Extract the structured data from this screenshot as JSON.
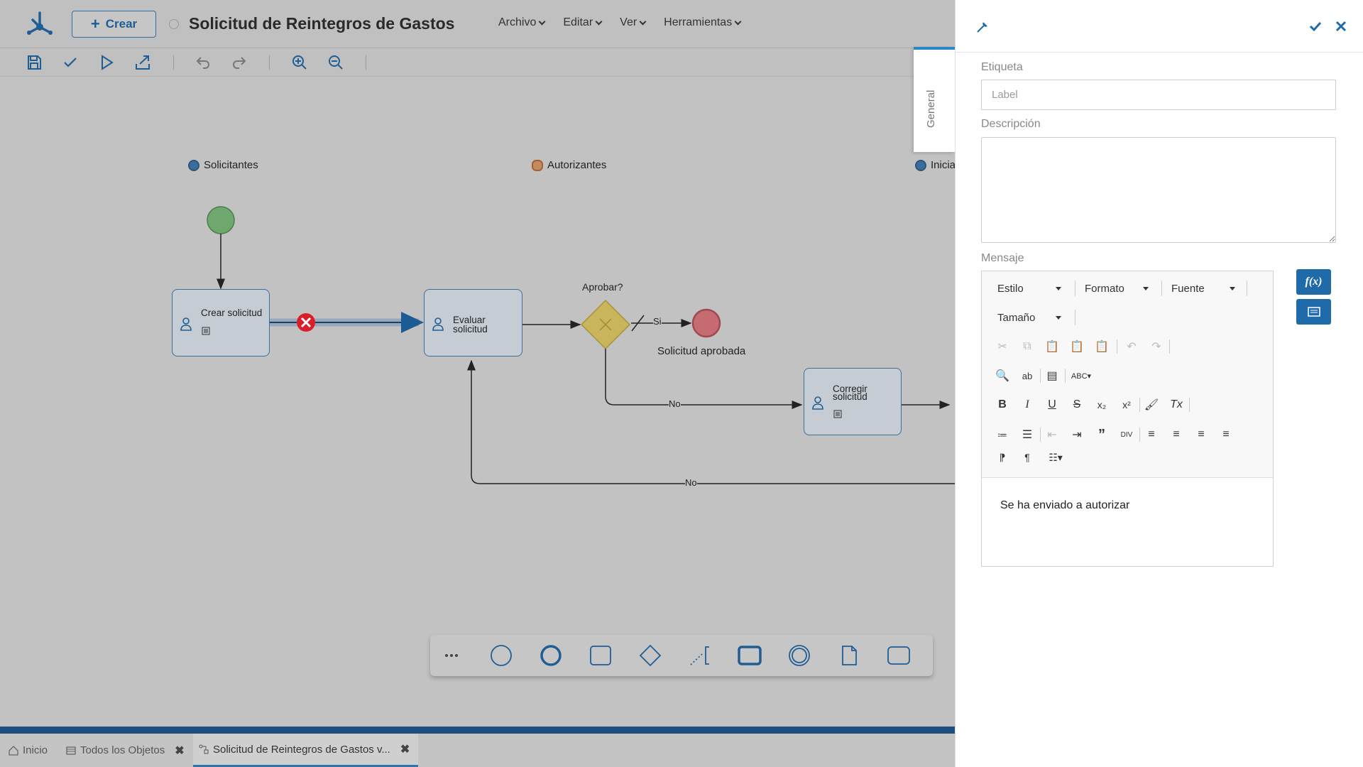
{
  "header": {
    "create_label": "Crear",
    "title": "Solicitud de Reintegros de Gastos",
    "menu": [
      {
        "label": "Archivo"
      },
      {
        "label": "Editar"
      },
      {
        "label": "Ver"
      },
      {
        "label": "Herramientas"
      }
    ]
  },
  "toolbar": {
    "icons": [
      "save-icon",
      "check-icon",
      "play-icon",
      "export-icon",
      "undo-icon",
      "redo-icon",
      "zoom-in-icon",
      "zoom-out-icon"
    ]
  },
  "diagram": {
    "lanes": [
      {
        "label": "Solicitantes"
      },
      {
        "label": "Autorizantes"
      },
      {
        "label": "Inicia"
      }
    ],
    "tasks": [
      {
        "label_1": "Crear solicitud",
        "label_2": ""
      },
      {
        "label_1": "Evaluar",
        "label_2": "solicitud"
      },
      {
        "label_1": "Corregir",
        "label_2": "solicitud"
      }
    ],
    "gateway_label": "Aprobar?",
    "end_label": "Solicitud aprobada",
    "flow_labels": {
      "si": "Si",
      "no_1": "No",
      "no_2": "No"
    }
  },
  "bottom_tabs": [
    {
      "label": "Inicio"
    },
    {
      "label": "Todos los Objetos"
    },
    {
      "label": "Solicitud de Reintegros de Gastos v..."
    }
  ],
  "panel": {
    "side_tab": "General",
    "etiqueta_label": "Etiqueta",
    "etiqueta_placeholder": "Label",
    "descripcion_label": "Descripción",
    "descripcion_value": "",
    "mensaje_label": "Mensaje",
    "editor": {
      "combos": [
        {
          "label": "Estilo"
        },
        {
          "label": "Formato"
        },
        {
          "label": "Fuente"
        },
        {
          "label": "Tamaño"
        }
      ],
      "content": "Se ha enviado a autorizar"
    },
    "fx_label": "f(x)"
  },
  "colors": {
    "accent": "#1f6aa8",
    "start_event": "#6ea86e",
    "end_event": "#c76b73",
    "gateway": "#c9b65c",
    "error": "#d91f2a"
  }
}
